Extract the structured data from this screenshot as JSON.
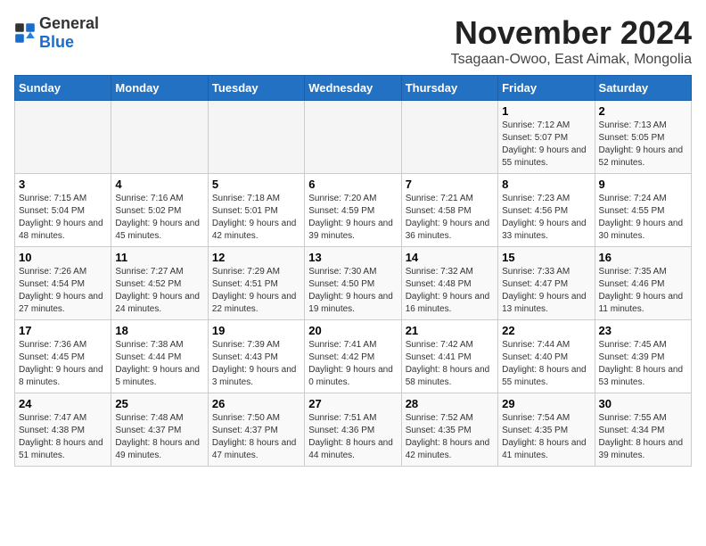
{
  "logo": {
    "general": "General",
    "blue": "Blue"
  },
  "title": "November 2024",
  "subtitle": "Tsagaan-Owoo, East Aimak, Mongolia",
  "days_of_week": [
    "Sunday",
    "Monday",
    "Tuesday",
    "Wednesday",
    "Thursday",
    "Friday",
    "Saturday"
  ],
  "weeks": [
    [
      {
        "day": "",
        "info": ""
      },
      {
        "day": "",
        "info": ""
      },
      {
        "day": "",
        "info": ""
      },
      {
        "day": "",
        "info": ""
      },
      {
        "day": "",
        "info": ""
      },
      {
        "day": "1",
        "info": "Sunrise: 7:12 AM\nSunset: 5:07 PM\nDaylight: 9 hours and 55 minutes."
      },
      {
        "day": "2",
        "info": "Sunrise: 7:13 AM\nSunset: 5:05 PM\nDaylight: 9 hours and 52 minutes."
      }
    ],
    [
      {
        "day": "3",
        "info": "Sunrise: 7:15 AM\nSunset: 5:04 PM\nDaylight: 9 hours and 48 minutes."
      },
      {
        "day": "4",
        "info": "Sunrise: 7:16 AM\nSunset: 5:02 PM\nDaylight: 9 hours and 45 minutes."
      },
      {
        "day": "5",
        "info": "Sunrise: 7:18 AM\nSunset: 5:01 PM\nDaylight: 9 hours and 42 minutes."
      },
      {
        "day": "6",
        "info": "Sunrise: 7:20 AM\nSunset: 4:59 PM\nDaylight: 9 hours and 39 minutes."
      },
      {
        "day": "7",
        "info": "Sunrise: 7:21 AM\nSunset: 4:58 PM\nDaylight: 9 hours and 36 minutes."
      },
      {
        "day": "8",
        "info": "Sunrise: 7:23 AM\nSunset: 4:56 PM\nDaylight: 9 hours and 33 minutes."
      },
      {
        "day": "9",
        "info": "Sunrise: 7:24 AM\nSunset: 4:55 PM\nDaylight: 9 hours and 30 minutes."
      }
    ],
    [
      {
        "day": "10",
        "info": "Sunrise: 7:26 AM\nSunset: 4:54 PM\nDaylight: 9 hours and 27 minutes."
      },
      {
        "day": "11",
        "info": "Sunrise: 7:27 AM\nSunset: 4:52 PM\nDaylight: 9 hours and 24 minutes."
      },
      {
        "day": "12",
        "info": "Sunrise: 7:29 AM\nSunset: 4:51 PM\nDaylight: 9 hours and 22 minutes."
      },
      {
        "day": "13",
        "info": "Sunrise: 7:30 AM\nSunset: 4:50 PM\nDaylight: 9 hours and 19 minutes."
      },
      {
        "day": "14",
        "info": "Sunrise: 7:32 AM\nSunset: 4:48 PM\nDaylight: 9 hours and 16 minutes."
      },
      {
        "day": "15",
        "info": "Sunrise: 7:33 AM\nSunset: 4:47 PM\nDaylight: 9 hours and 13 minutes."
      },
      {
        "day": "16",
        "info": "Sunrise: 7:35 AM\nSunset: 4:46 PM\nDaylight: 9 hours and 11 minutes."
      }
    ],
    [
      {
        "day": "17",
        "info": "Sunrise: 7:36 AM\nSunset: 4:45 PM\nDaylight: 9 hours and 8 minutes."
      },
      {
        "day": "18",
        "info": "Sunrise: 7:38 AM\nSunset: 4:44 PM\nDaylight: 9 hours and 5 minutes."
      },
      {
        "day": "19",
        "info": "Sunrise: 7:39 AM\nSunset: 4:43 PM\nDaylight: 9 hours and 3 minutes."
      },
      {
        "day": "20",
        "info": "Sunrise: 7:41 AM\nSunset: 4:42 PM\nDaylight: 9 hours and 0 minutes."
      },
      {
        "day": "21",
        "info": "Sunrise: 7:42 AM\nSunset: 4:41 PM\nDaylight: 8 hours and 58 minutes."
      },
      {
        "day": "22",
        "info": "Sunrise: 7:44 AM\nSunset: 4:40 PM\nDaylight: 8 hours and 55 minutes."
      },
      {
        "day": "23",
        "info": "Sunrise: 7:45 AM\nSunset: 4:39 PM\nDaylight: 8 hours and 53 minutes."
      }
    ],
    [
      {
        "day": "24",
        "info": "Sunrise: 7:47 AM\nSunset: 4:38 PM\nDaylight: 8 hours and 51 minutes."
      },
      {
        "day": "25",
        "info": "Sunrise: 7:48 AM\nSunset: 4:37 PM\nDaylight: 8 hours and 49 minutes."
      },
      {
        "day": "26",
        "info": "Sunrise: 7:50 AM\nSunset: 4:37 PM\nDaylight: 8 hours and 47 minutes."
      },
      {
        "day": "27",
        "info": "Sunrise: 7:51 AM\nSunset: 4:36 PM\nDaylight: 8 hours and 44 minutes."
      },
      {
        "day": "28",
        "info": "Sunrise: 7:52 AM\nSunset: 4:35 PM\nDaylight: 8 hours and 42 minutes."
      },
      {
        "day": "29",
        "info": "Sunrise: 7:54 AM\nSunset: 4:35 PM\nDaylight: 8 hours and 41 minutes."
      },
      {
        "day": "30",
        "info": "Sunrise: 7:55 AM\nSunset: 4:34 PM\nDaylight: 8 hours and 39 minutes."
      }
    ]
  ]
}
